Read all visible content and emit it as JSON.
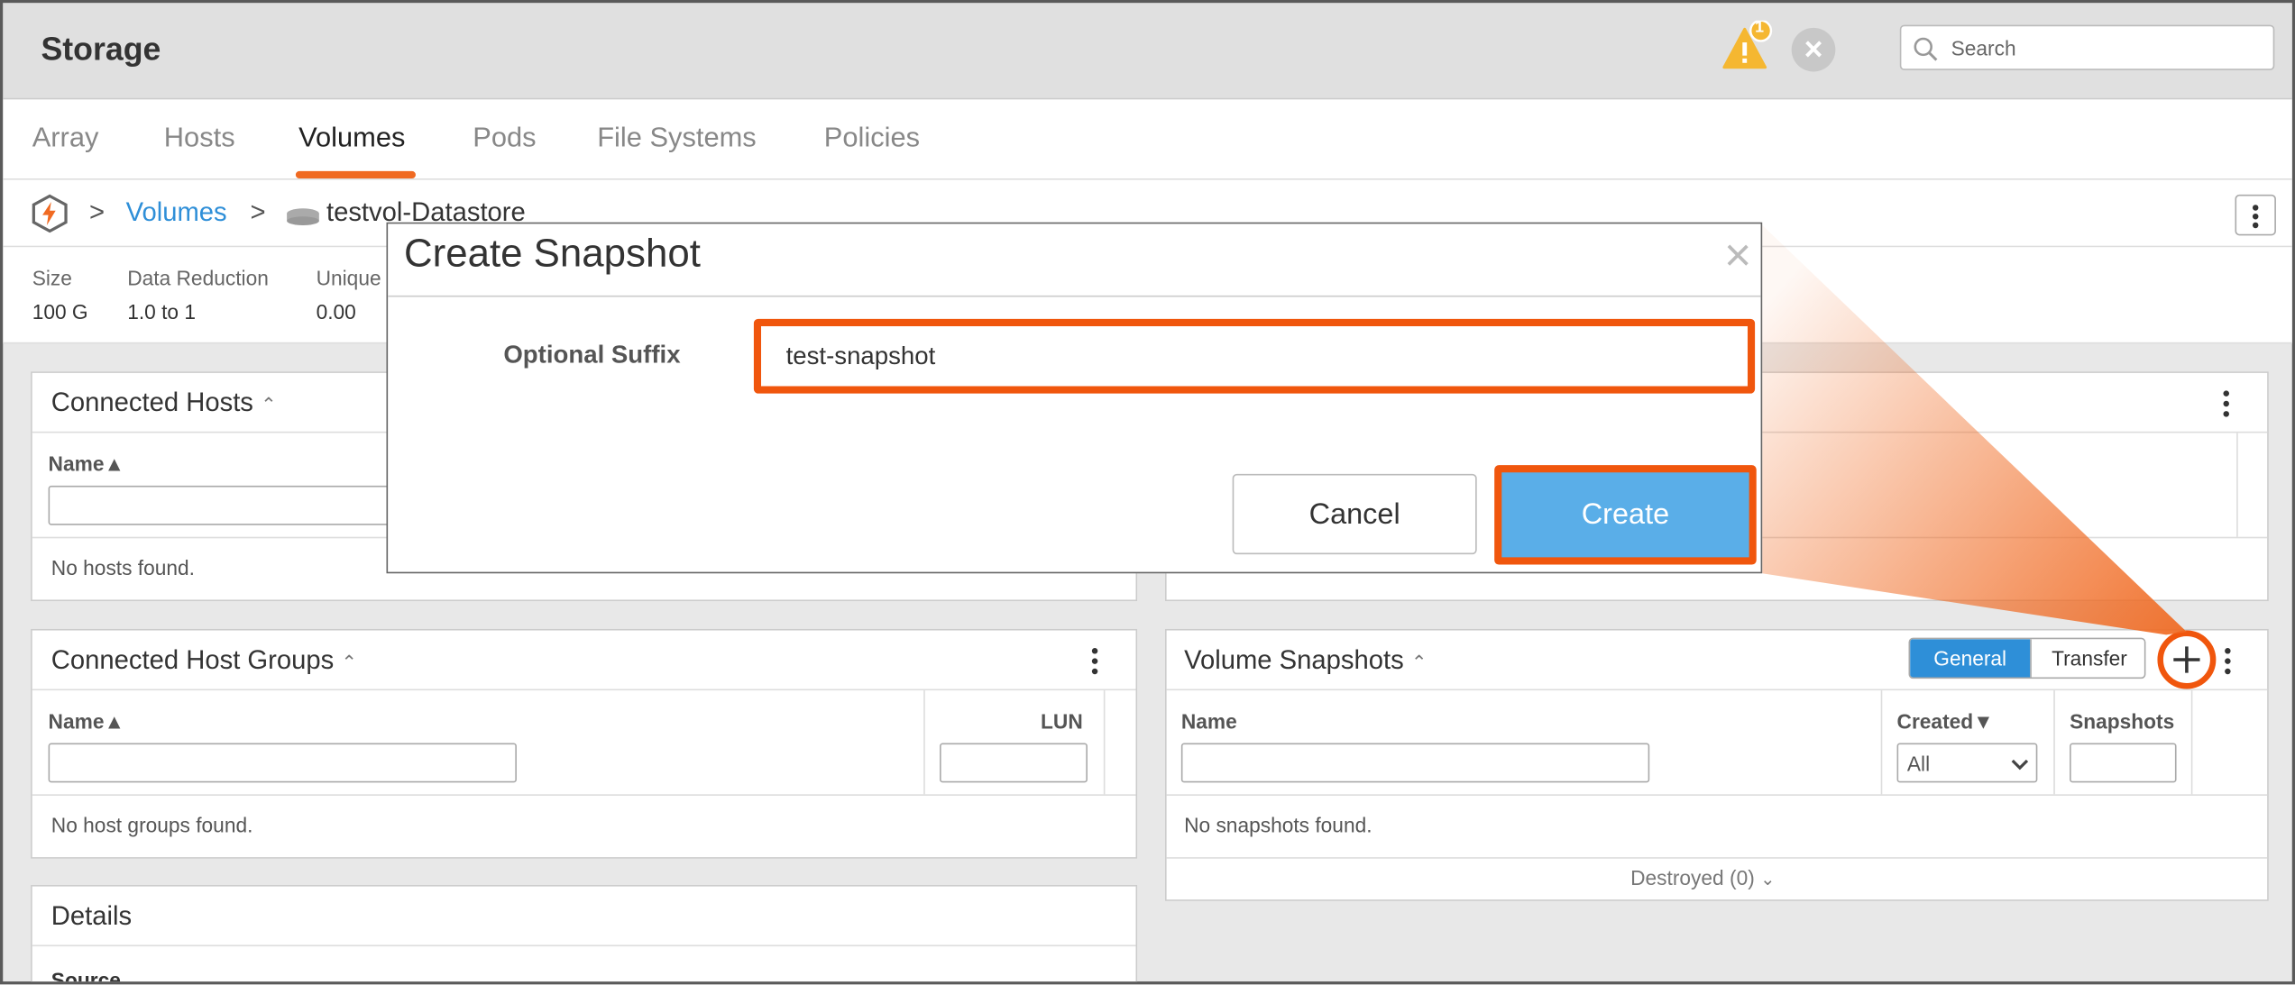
{
  "header": {
    "title": "Storage",
    "alert_count": "1",
    "search_placeholder": "Search"
  },
  "tabs": [
    "Array",
    "Hosts",
    "Volumes",
    "Pods",
    "File Systems",
    "Policies"
  ],
  "breadcrumb": {
    "separator": ">",
    "link": "Volumes",
    "current": "testvol-Datastore"
  },
  "stats": [
    {
      "label": "Size",
      "value": "100 G"
    },
    {
      "label": "Data Reduction",
      "value": "1.0 to 1"
    },
    {
      "label": "Unique",
      "value": "0.00"
    }
  ],
  "connected_hosts": {
    "title": "Connected Hosts",
    "col_name": "Name",
    "empty": "No hosts found."
  },
  "connected_host_groups": {
    "title": "Connected Host Groups",
    "col_name": "Name",
    "col_lun": "LUN",
    "empty": "No host groups found."
  },
  "details": {
    "title": "Details",
    "source_label": "Source"
  },
  "volume_snapshots": {
    "title": "Volume Snapshots",
    "toggle": {
      "active": "General",
      "inactive": "Transfer"
    },
    "col_name": "Name",
    "col_created": "Created",
    "col_snapshots": "Snapshots",
    "created_filter": "All",
    "empty": "No snapshots found.",
    "destroyed": "Destroyed (0)"
  },
  "modal": {
    "title": "Create Snapshot",
    "field_label": "Optional Suffix",
    "field_value": "test-snapshot",
    "cancel": "Cancel",
    "create": "Create"
  },
  "colors": {
    "accent": "#f06a22",
    "highlight": "#f0560d",
    "primary": "#5aaee8",
    "link": "#2f8fd8"
  }
}
